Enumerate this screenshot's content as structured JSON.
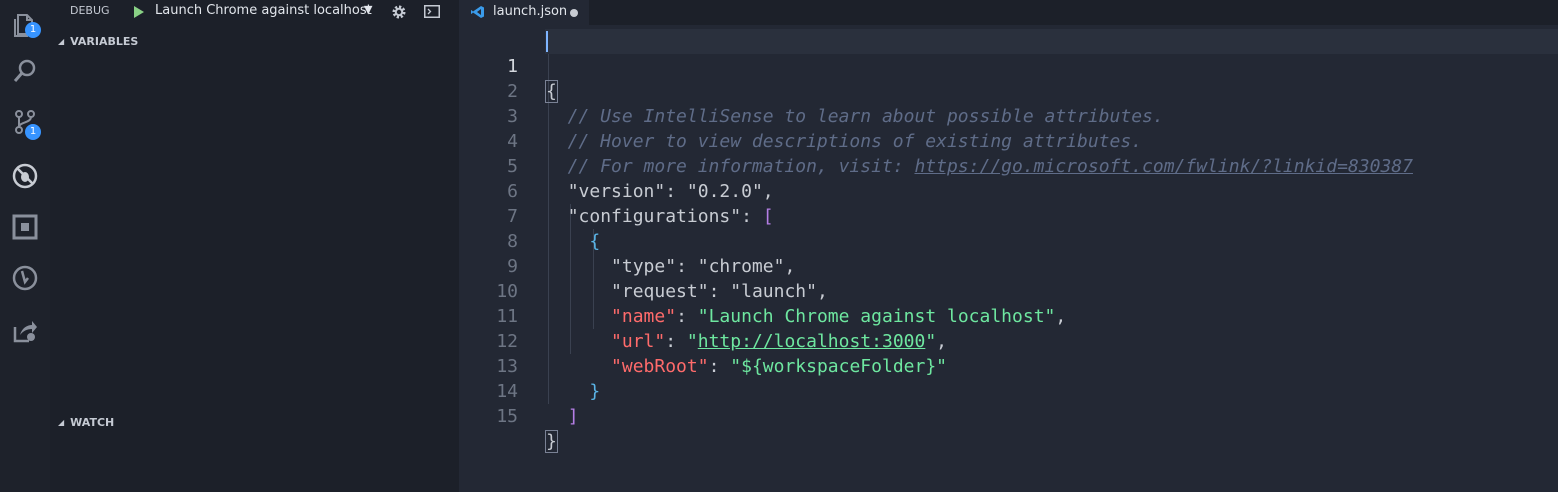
{
  "activity_bar": {
    "items": [
      {
        "icon": "files-icon",
        "badge": "1"
      },
      {
        "icon": "search-icon"
      },
      {
        "icon": "source-control-icon",
        "badge": "1"
      },
      {
        "icon": "debug-icon"
      },
      {
        "icon": "extensions-icon"
      },
      {
        "icon": "git-history-icon"
      },
      {
        "icon": "live-share-icon"
      }
    ]
  },
  "sidebar": {
    "title": "DEBUG",
    "configuration": "Launch Chrome against localhost",
    "dropdown_glyph": "▼",
    "sections": {
      "variables": "VARIABLES",
      "watch": "WATCH"
    }
  },
  "tabs": [
    {
      "label": "launch.json",
      "dirty": true,
      "active": true
    }
  ],
  "editor": {
    "current_line": 1,
    "lines": [
      {
        "n": "1",
        "text": "{"
      },
      {
        "n": "2",
        "text": "  // Use IntelliSense to learn about possible attributes."
      },
      {
        "n": "3",
        "text": "  // Hover to view descriptions of existing attributes."
      },
      {
        "n": "4",
        "text": "  // For more information, visit: ",
        "link": "https://go.microsoft.com/fwlink/?linkid=830387"
      },
      {
        "n": "5",
        "key": "\"version\"",
        "value": "\"0.2.0\""
      },
      {
        "n": "6",
        "key": "\"configurations\"",
        "bracket": "["
      },
      {
        "n": "7",
        "text": "{"
      },
      {
        "n": "8",
        "key": "\"type\"",
        "value": "\"chrome\""
      },
      {
        "n": "9",
        "key": "\"request\"",
        "value": "\"launch\""
      },
      {
        "n": "10",
        "key": "\"name\"",
        "value": "\"Launch Chrome against localhost\""
      },
      {
        "n": "11",
        "key": "\"url\"",
        "value_url": "http://localhost:3000"
      },
      {
        "n": "12",
        "key": "\"webRoot\"",
        "value": "\"${workspaceFolder}\""
      },
      {
        "n": "13",
        "text": "}"
      },
      {
        "n": "14",
        "text": "]"
      },
      {
        "n": "15",
        "text": "}"
      }
    ]
  },
  "colors": {
    "background": "#232834",
    "sidebar": "#1c2029",
    "activity_bar": "#1e222b",
    "accent_badge": "#3794ff",
    "string_green": "#6ee7a0",
    "key_red": "#ff6b6b",
    "comment": "#5f6c88"
  }
}
